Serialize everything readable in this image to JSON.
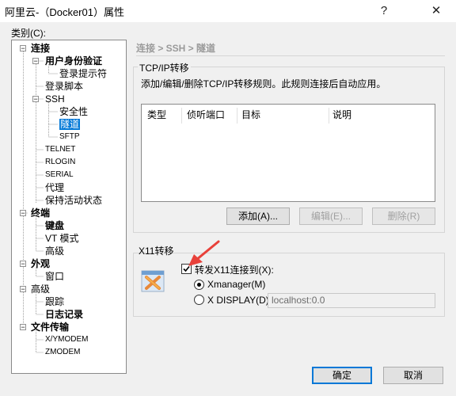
{
  "window": {
    "title": "阿里云-（Docker01）属性",
    "help_glyph": "?",
    "close_glyph": "✕"
  },
  "category_label": "类别(C):",
  "tree": [
    {
      "label": "连接",
      "bold": true,
      "expander": "−"
    },
    {
      "label": "用户身份验证",
      "bold": true,
      "expander": "−"
    },
    {
      "label": "登录提示符"
    },
    {
      "label": "登录脚本"
    },
    {
      "label": "SSH",
      "expander": "−"
    },
    {
      "label": "安全性"
    },
    {
      "label": "隧道",
      "selected": true
    },
    {
      "label": "SFTP",
      "small": true
    },
    {
      "label": "TELNET",
      "small": true
    },
    {
      "label": "RLOGIN",
      "small": true
    },
    {
      "label": "SERIAL",
      "small": true
    },
    {
      "label": "代理"
    },
    {
      "label": "保持活动状态"
    },
    {
      "label": "终端",
      "bold": true,
      "expander": "−"
    },
    {
      "label": "键盘",
      "bold": true
    },
    {
      "label": "VT 模式"
    },
    {
      "label": "高级"
    },
    {
      "label": "外观",
      "bold": true,
      "expander": "−"
    },
    {
      "label": "窗口"
    },
    {
      "label": "高级",
      "expander": "−"
    },
    {
      "label": "跟踪"
    },
    {
      "label": "日志记录",
      "bold": true
    },
    {
      "label": "文件传输",
      "bold": true,
      "expander": "−"
    },
    {
      "label": "X/YMODEM",
      "small": true
    },
    {
      "label": "ZMODEM",
      "small": true
    }
  ],
  "breadcrumb": "连接 > SSH > 隧道",
  "tcp": {
    "group_title": "TCP/IP转移",
    "description": "添加/编辑/删除TCP/IP转移规则。此规则连接后自动应用。",
    "columns": [
      "类型",
      "侦听端口",
      "目标",
      "说明"
    ],
    "add_label": "添加(A)...",
    "edit_label": "编辑(E)...",
    "delete_label": "删除(R)"
  },
  "x11": {
    "group_title": "X11转移",
    "forward_label": "转发X11连接到(X):",
    "forward_checked": true,
    "xmanager_label": "Xmanager(M)",
    "xdisplay_label": "X DISPLAY(D):",
    "xdisplay_value": "localhost:0.0",
    "selected_option": "Xmanager(M)",
    "icon": "xmanager-icon"
  },
  "footer": {
    "ok_label": "确定",
    "cancel_label": "取消"
  },
  "colors": {
    "selection": "#0078d7",
    "annotation_arrow": "#e8413a"
  }
}
